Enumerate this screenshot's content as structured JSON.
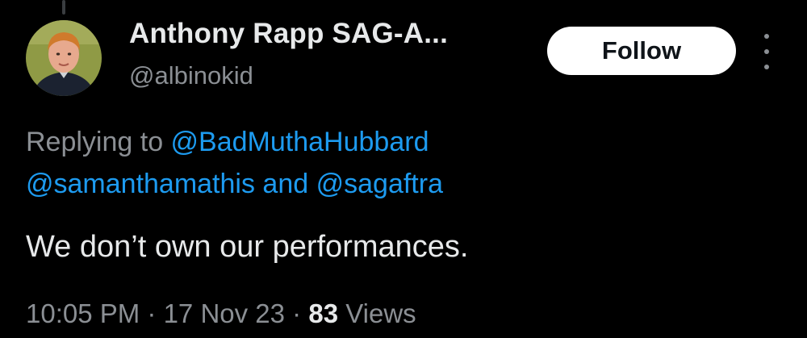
{
  "author": {
    "display_name": "Anthony Rapp SAG-A...",
    "handle": "@albinokid"
  },
  "follow_button": {
    "label": "Follow"
  },
  "more_icon": "more-vertical-icon",
  "reply_context": {
    "prefix": "Replying to ",
    "mention_1": "@BadMuthaHubbard",
    "mention_2": "@samanthamathis",
    "conjunction": " and ",
    "mention_3": "@sagaftra"
  },
  "tweet": {
    "text": "We don’t own our performances."
  },
  "meta": {
    "time": "10:05 PM",
    "separator_1": " · ",
    "date": "17 Nov 23",
    "separator_2": " · ",
    "views_count": "83",
    "views_label": " Views"
  },
  "colors": {
    "background": "#000000",
    "primary_text": "#e7e9ea",
    "secondary_text": "#8b8f94",
    "link": "#1d9bf0",
    "button_bg": "#ffffff"
  }
}
